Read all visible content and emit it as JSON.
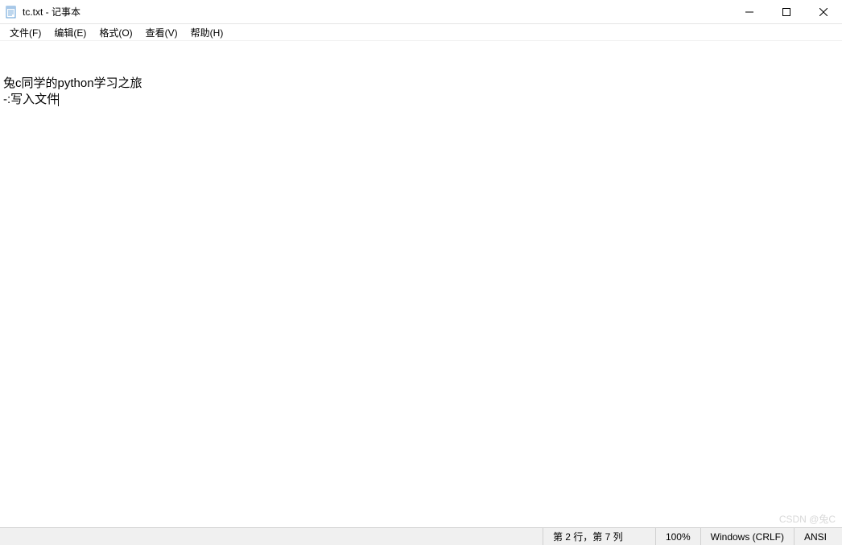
{
  "titlebar": {
    "title": "tc.txt - 记事本"
  },
  "menu": {
    "file": "文件(F)",
    "edit": "编辑(E)",
    "format": "格式(O)",
    "view": "查看(V)",
    "help": "帮助(H)"
  },
  "content": {
    "line1": "兔c同学的python学习之旅",
    "line2": "-:写入文件"
  },
  "statusbar": {
    "position": "第 2 行，第 7 列",
    "zoom": "100%",
    "line_ending": "Windows (CRLF)",
    "encoding": "ANSI"
  },
  "watermark": "CSDN @兔C"
}
